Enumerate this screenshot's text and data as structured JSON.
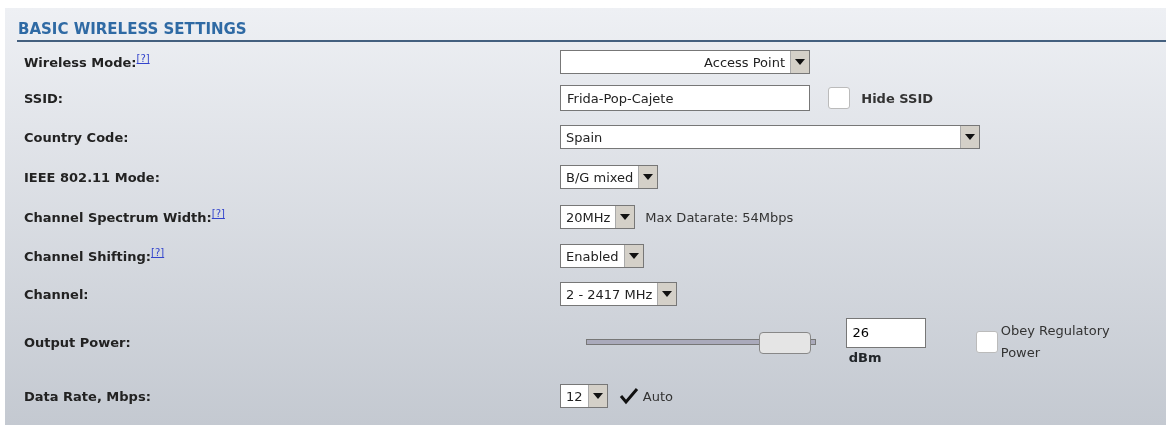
{
  "section": {
    "title": "BASIC WIRELESS SETTINGS"
  },
  "rows": [
    {
      "label": "Wireless Mode:",
      "help": "[?]",
      "controls": [
        {
          "kind": "select",
          "value": "Access Point"
        }
      ]
    },
    {
      "label": "SSID:",
      "controls": [
        {
          "kind": "text",
          "value": "Frida-Pop-Cajete"
        },
        {
          "kind": "checkbox",
          "label": "Hide SSID",
          "checked": false
        }
      ]
    },
    {
      "label": "Country Code:",
      "controls": [
        {
          "kind": "select",
          "value": "Spain"
        }
      ]
    },
    {
      "label": "IEEE 802.11 Mode:",
      "controls": [
        {
          "kind": "select",
          "value": "B/G mixed"
        }
      ]
    },
    {
      "label": "Channel Spectrum Width:",
      "help": "[?]",
      "controls": [
        {
          "kind": "select",
          "value": "20MHz"
        },
        {
          "kind": "note",
          "value": "Max Datarate: 54Mbps"
        }
      ]
    },
    {
      "label": "Channel Shifting:",
      "help": "[?]",
      "controls": [
        {
          "kind": "select",
          "value": "Enabled"
        }
      ]
    },
    {
      "label": "Channel:",
      "controls": [
        {
          "kind": "select",
          "value": "2 - 2417 MHz"
        }
      ]
    },
    {
      "label": "Output Power:",
      "controls": [
        {
          "kind": "slider",
          "level": 0.87,
          "value": "26",
          "unit": "dBm"
        },
        {
          "kind": "checkbox",
          "label": "Obey Regulatory Power",
          "checked": false
        }
      ]
    },
    {
      "label": "Data Rate, Mbps:",
      "controls": [
        {
          "kind": "select",
          "value": "12"
        },
        {
          "kind": "checkbox",
          "label": "Auto",
          "checked": true
        }
      ]
    }
  ]
}
